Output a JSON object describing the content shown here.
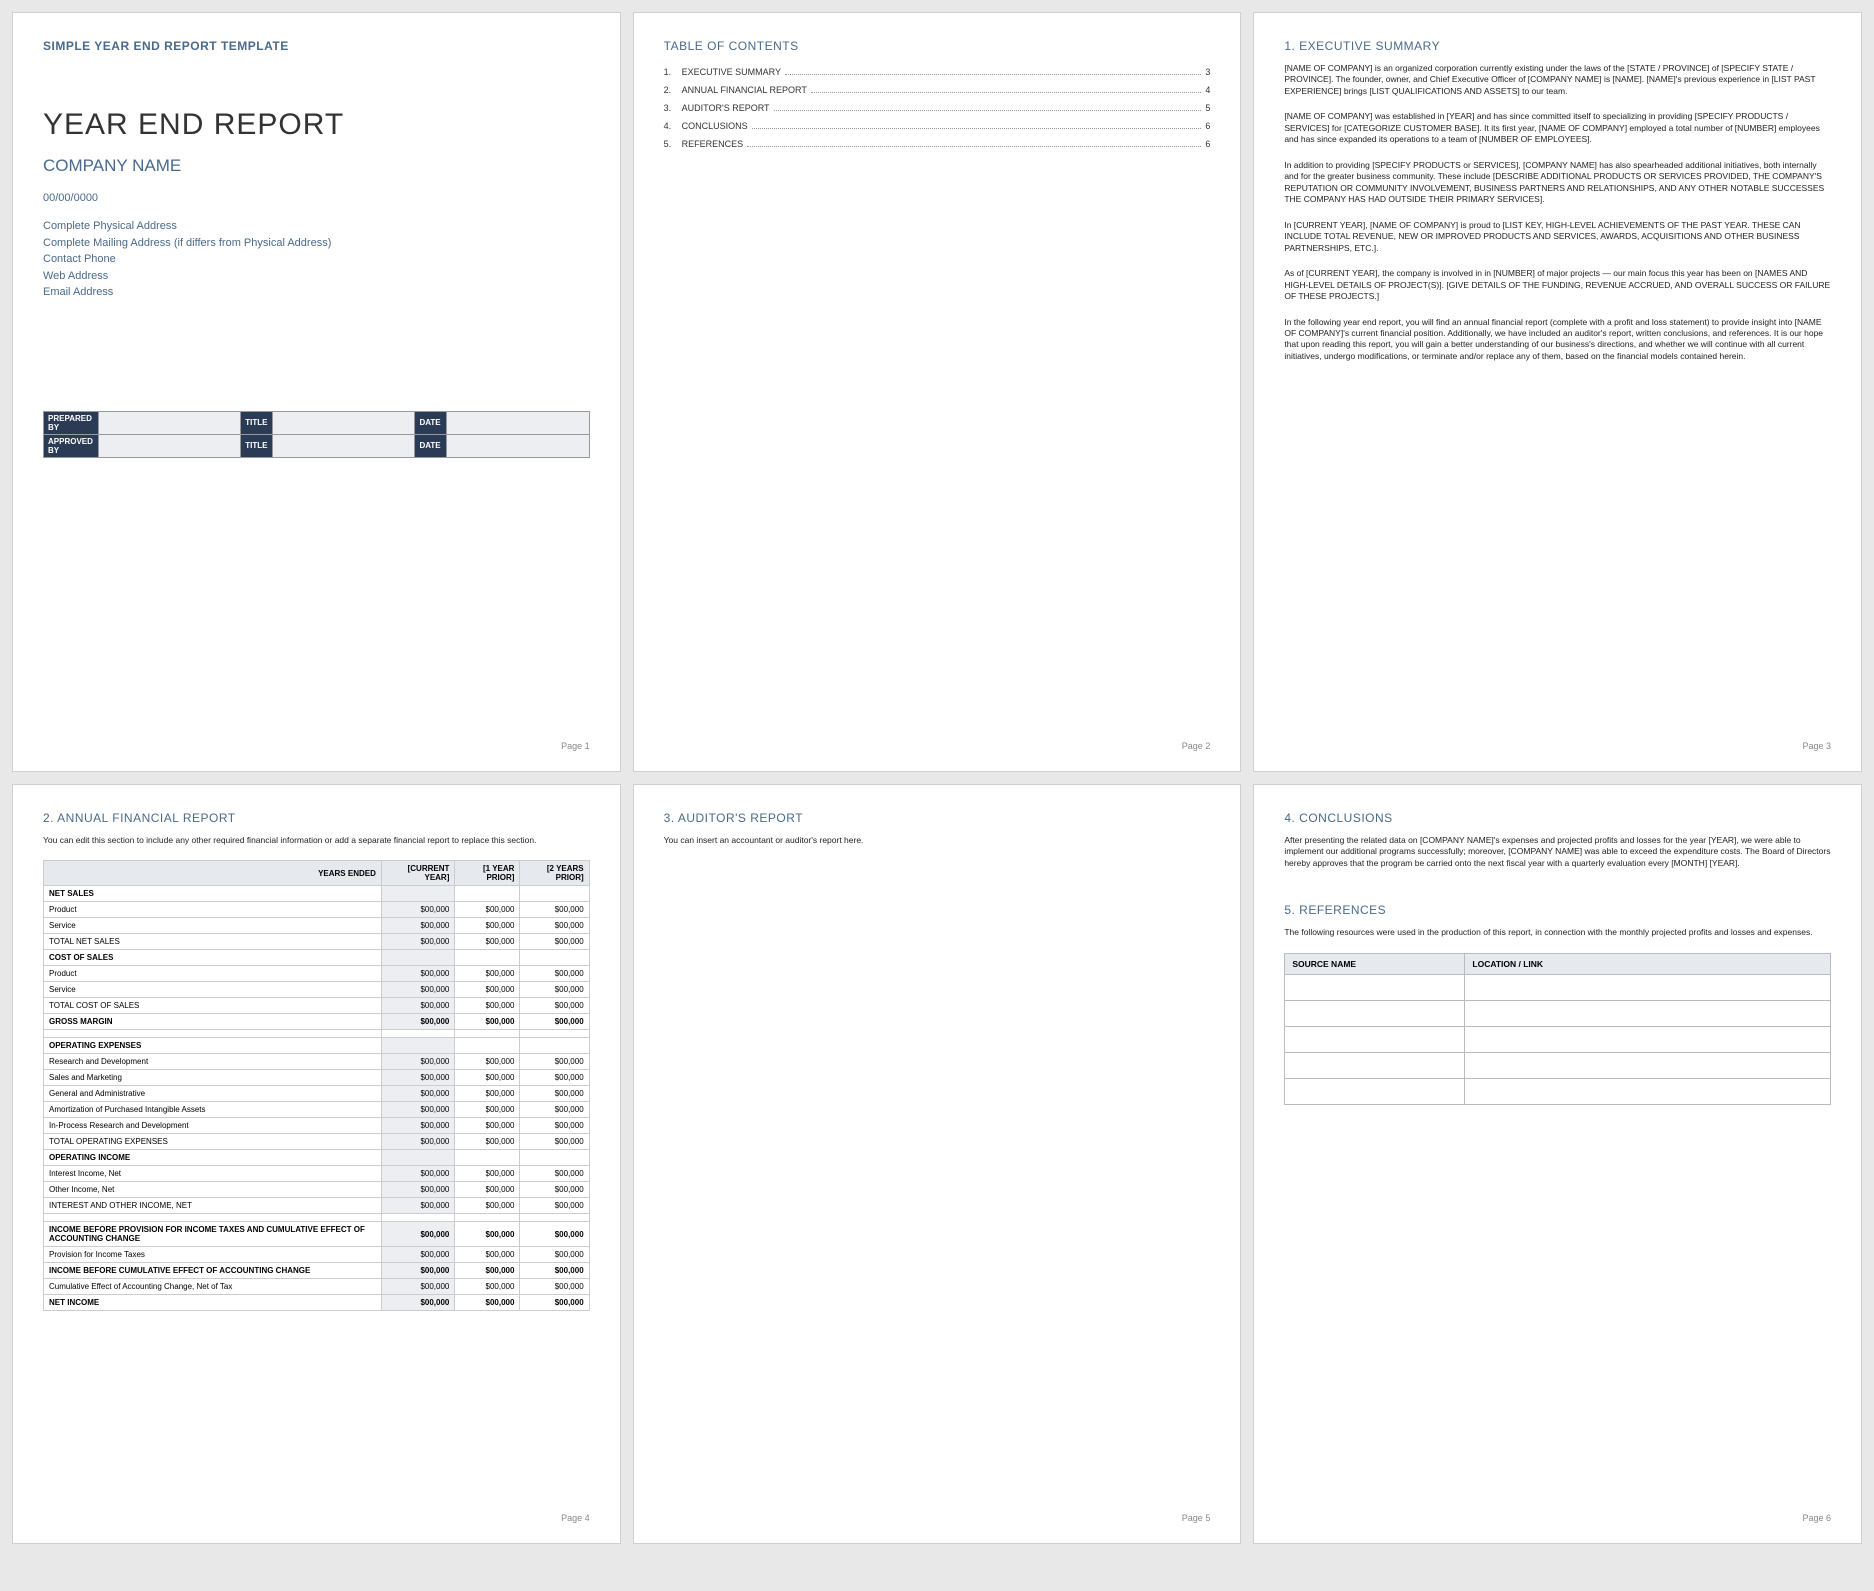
{
  "page1": {
    "template_header": "SIMPLE YEAR END REPORT TEMPLATE",
    "title": "YEAR END REPORT",
    "company": "COMPANY NAME",
    "date": "00/00/0000",
    "addr_physical": "Complete Physical Address",
    "addr_mailing": "Complete Mailing Address (if differs from Physical Address)",
    "phone": "Contact Phone",
    "web": "Web Address",
    "email": "Email Address",
    "sig": {
      "prepared_by": "PREPARED BY",
      "approved_by": "APPROVED BY",
      "title": "TITLE",
      "date": "DATE"
    },
    "page_label": "Page 1"
  },
  "page2": {
    "heading": "TABLE OF CONTENTS",
    "items": [
      {
        "n": "1.",
        "label": "EXECUTIVE SUMMARY",
        "pg": "3"
      },
      {
        "n": "2.",
        "label": "ANNUAL FINANCIAL REPORT",
        "pg": "4"
      },
      {
        "n": "3.",
        "label": "AUDITOR'S REPORT",
        "pg": "5"
      },
      {
        "n": "4.",
        "label": "CONCLUSIONS",
        "pg": "6"
      },
      {
        "n": "5.",
        "label": "REFERENCES",
        "pg": "6"
      }
    ],
    "page_label": "Page 2"
  },
  "page3": {
    "heading": "1. EXECUTIVE SUMMARY",
    "p1": "[NAME OF COMPANY] is an organized corporation currently existing under the laws of the [STATE / PROVINCE] of [SPECIFY STATE / PROVINCE]. The founder, owner, and Chief Executive Officer of [COMPANY NAME] is [NAME]. [NAME]'s previous experience in [LIST PAST EXPERIENCE] brings [LIST QUALIFICATIONS AND ASSETS] to our team.",
    "p2": "[NAME OF COMPANY] was established in [YEAR] and has since committed itself to specializing in providing [SPECIFY PRODUCTS / SERVICES] for [CATEGORIZE CUSTOMER BASE]. It its first year, [NAME OF COMPANY] employed a total number of [NUMBER] employees and has since expanded its operations to a team of [NUMBER OF EMPLOYEES].",
    "p3": "In addition to providing [SPECIFY PRODUCTS or SERVICES], [COMPANY NAME] has also spearheaded additional initiatives, both internally and for the greater business community. These include [DESCRIBE ADDITIONAL PRODUCTS OR SERVICES PROVIDED, THE COMPANY'S REPUTATION OR COMMUNITY INVOLVEMENT, BUSINESS PARTNERS AND RELATIONSHIPS, AND ANY OTHER NOTABLE SUCCESSES THE COMPANY HAS HAD OUTSIDE THEIR PRIMARY SERVICES].",
    "p4": "In [CURRENT YEAR], [NAME OF COMPANY] is proud to [LIST KEY, HIGH-LEVEL ACHIEVEMENTS OF THE PAST YEAR. THESE CAN INCLUDE TOTAL REVENUE, NEW OR IMPROVED PRODUCTS AND SERVICES, AWARDS, ACQUISITIONS AND OTHER BUSINESS PARTNERSHIPS, ETC.].",
    "p5": "As of [CURRENT YEAR], the company is involved in in [NUMBER] of major projects — our main focus this year has been on [NAMES AND HIGH-LEVEL DETAILS OF PROJECT(S)]. [GIVE DETAILS OF THE FUNDING, REVENUE ACCRUED, AND OVERALL SUCCESS OR FAILURE OF THESE PROJECTS.]",
    "p6": "In the following year end report, you will find an annual financial report (complete with a profit and loss statement) to provide insight into [NAME OF COMPANY]'s current financial position. Additionally, we have included an auditor's report, written conclusions, and references. It is our hope that upon reading this report, you will gain a better understanding of our business's directions, and whether we will continue with all current initiatives, undergo modifications, or terminate and/or replace any of them, based on the financial models contained herein.",
    "page_label": "Page 3"
  },
  "page4": {
    "heading": "2. ANNUAL FINANCIAL REPORT",
    "intro": "You can edit this section to include any other required financial information or add a separate financial report to replace this section.",
    "cols": {
      "c0": "YEARS ENDED",
      "c1": "[CURRENT YEAR]",
      "c2": "[1 YEAR PRIOR]",
      "c3": "[2 YEARS PRIOR]"
    },
    "rows": [
      {
        "type": "section",
        "label": "NET SALES"
      },
      {
        "label": "Product",
        "v": [
          "$00,000",
          "$00,000",
          "$00,000"
        ]
      },
      {
        "label": "Service",
        "v": [
          "$00,000",
          "$00,000",
          "$00,000"
        ]
      },
      {
        "label": "TOTAL NET SALES",
        "v": [
          "$00,000",
          "$00,000",
          "$00,000"
        ]
      },
      {
        "type": "section",
        "label": "COST OF SALES"
      },
      {
        "label": "Product",
        "v": [
          "$00,000",
          "$00,000",
          "$00,000"
        ]
      },
      {
        "label": "Service",
        "v": [
          "$00,000",
          "$00,000",
          "$00,000"
        ]
      },
      {
        "label": "TOTAL COST OF SALES",
        "v": [
          "$00,000",
          "$00,000",
          "$00,000"
        ]
      },
      {
        "type": "bold",
        "label": "GROSS MARGIN",
        "v": [
          "$00,000",
          "$00,000",
          "$00,000"
        ]
      },
      {
        "type": "spacer"
      },
      {
        "type": "section",
        "label": "OPERATING EXPENSES"
      },
      {
        "label": "Research and Development",
        "v": [
          "$00,000",
          "$00,000",
          "$00,000"
        ]
      },
      {
        "label": "Sales and Marketing",
        "v": [
          "$00,000",
          "$00,000",
          "$00,000"
        ]
      },
      {
        "label": "General and Administrative",
        "v": [
          "$00,000",
          "$00,000",
          "$00,000"
        ]
      },
      {
        "label": "Amortization of Purchased Intangible Assets",
        "v": [
          "$00,000",
          "$00,000",
          "$00,000"
        ]
      },
      {
        "label": "In-Process Research and Development",
        "v": [
          "$00,000",
          "$00,000",
          "$00,000"
        ]
      },
      {
        "label": "TOTAL OPERATING EXPENSES",
        "v": [
          "$00,000",
          "$00,000",
          "$00,000"
        ]
      },
      {
        "type": "section",
        "label": "OPERATING INCOME"
      },
      {
        "label": "Interest Income, Net",
        "v": [
          "$00,000",
          "$00,000",
          "$00,000"
        ]
      },
      {
        "label": "Other Income, Net",
        "v": [
          "$00,000",
          "$00,000",
          "$00,000"
        ]
      },
      {
        "label": "INTEREST AND OTHER INCOME, NET",
        "v": [
          "$00,000",
          "$00,000",
          "$00,000"
        ]
      },
      {
        "type": "spacer"
      },
      {
        "type": "bold",
        "label": "INCOME BEFORE PROVISION FOR INCOME TAXES AND CUMULATIVE EFFECT OF ACCOUNTING CHANGE",
        "v": [
          "$00,000",
          "$00,000",
          "$00,000"
        ]
      },
      {
        "label": "Provision for Income Taxes",
        "v": [
          "$00,000",
          "$00,000",
          "$00,000"
        ]
      },
      {
        "type": "bold",
        "label": "INCOME BEFORE CUMULATIVE EFFECT OF ACCOUNTING CHANGE",
        "v": [
          "$00,000",
          "$00,000",
          "$00,000"
        ]
      },
      {
        "label": "Cumulative Effect of Accounting Change, Net of Tax",
        "v": [
          "$00,000",
          "$00,000",
          "$00,000"
        ]
      },
      {
        "type": "bold",
        "label": "NET INCOME",
        "v": [
          "$00,000",
          "$00,000",
          "$00,000"
        ]
      }
    ],
    "page_label": "Page 4"
  },
  "page5": {
    "heading": "3. AUDITOR'S REPORT",
    "intro": "You can insert an accountant or auditor's report here.",
    "page_label": "Page 5"
  },
  "page6": {
    "heading1": "4. CONCLUSIONS",
    "p1": "After presenting the related data on [COMPANY NAME]'s expenses and projected profits and losses for the year [YEAR], we were able to implement our additional programs successfully; moreover, [COMPANY NAME] was able to exceed the expenditure costs. The Board of Directors hereby approves that the program be carried onto the next fiscal year with a quarterly evaluation every [MONTH] [YEAR].",
    "heading2": "5. REFERENCES",
    "p2": "The following resources were used in the production of this report, in connection with the monthly projected profits and losses and expenses.",
    "ref_cols": {
      "c0": "SOURCE NAME",
      "c1": "LOCATION / LINK"
    },
    "page_label": "Page 6"
  }
}
